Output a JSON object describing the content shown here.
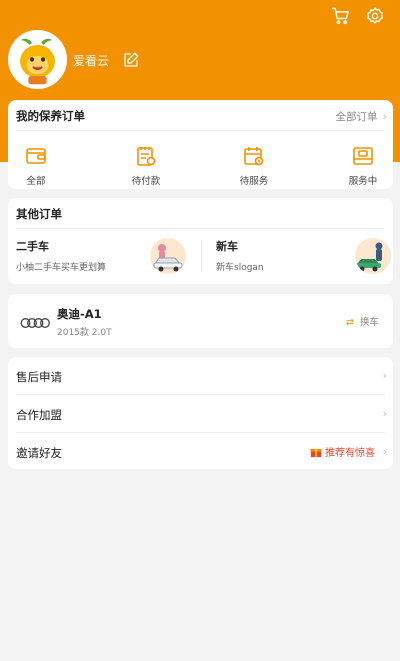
{
  "header": {
    "username": "爱看云",
    "cart_icon": "cart-icon",
    "settings_icon": "gear-icon",
    "background": "#f39200"
  },
  "maintenance_orders": {
    "title": "我的保养订单",
    "all_link": "全部订单",
    "items": [
      {
        "label": "全部",
        "icon": "wallet-icon"
      },
      {
        "label": "待付款",
        "icon": "invoice-icon"
      },
      {
        "label": "待服务",
        "icon": "calendar-icon"
      },
      {
        "label": "服务中",
        "icon": "service-icon"
      }
    ]
  },
  "other_orders": {
    "title": "其他订单",
    "items": [
      {
        "title": "二手车",
        "desc": "小柚二手车买车更划算"
      },
      {
        "title": "新车",
        "desc": "新车slogan"
      }
    ]
  },
  "car": {
    "name": "奥迪-A1",
    "spec": "2015款 2.0T",
    "switch_label": "换车"
  },
  "menu": {
    "items": [
      {
        "label": "售后申请"
      },
      {
        "label": "合作加盟"
      },
      {
        "label": "邀请好友",
        "badge": "推荐有惊喜"
      }
    ]
  },
  "colors": {
    "accent": "#f39200",
    "badge_red": "#e8472b"
  }
}
